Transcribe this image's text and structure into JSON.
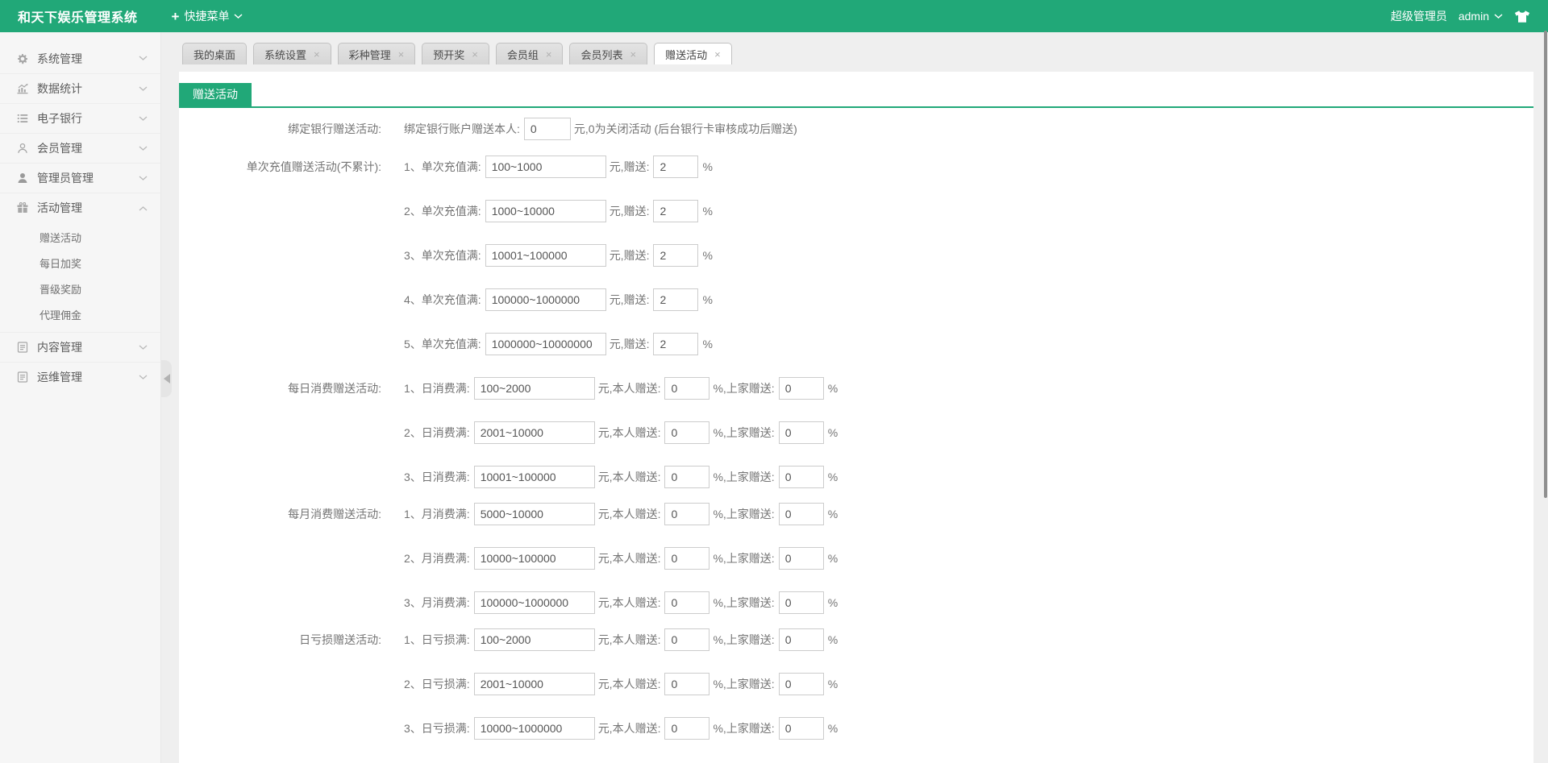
{
  "colors": {
    "primary": "#21a878"
  },
  "ui": {
    "close_glyph": "×"
  },
  "topbar": {
    "title": "和天下娱乐管理系统",
    "plus_glyph": "+",
    "quick_menu": "快捷菜单",
    "role": "超级管理员",
    "username": "admin"
  },
  "sidebar": {
    "items": [
      {
        "label": "系统管理",
        "icon": "gear-icon"
      },
      {
        "label": "数据统计",
        "icon": "bar-chart-icon"
      },
      {
        "label": "电子银行",
        "icon": "list-icon"
      },
      {
        "label": "会员管理",
        "icon": "user-outline-icon"
      },
      {
        "label": "管理员管理",
        "icon": "user-icon"
      },
      {
        "label": "活动管理",
        "icon": "gift-icon",
        "expanded": true,
        "children": [
          "赠送活动",
          "每日加奖",
          "晋级奖励",
          "代理佣金"
        ]
      },
      {
        "label": "内容管理",
        "icon": "content-icon"
      },
      {
        "label": "运维管理",
        "icon": "ops-icon"
      }
    ]
  },
  "tabs": [
    {
      "label": "我的桌面",
      "closable": false,
      "active": false
    },
    {
      "label": "系统设置",
      "closable": true,
      "active": false
    },
    {
      "label": "彩种管理",
      "closable": true,
      "active": false
    },
    {
      "label": "预开奖",
      "closable": true,
      "active": false
    },
    {
      "label": "会员组",
      "closable": true,
      "active": false
    },
    {
      "label": "会员列表",
      "closable": true,
      "active": false
    },
    {
      "label": "赠送活动",
      "closable": true,
      "active": true
    }
  ],
  "content": {
    "section_title": "赠送活动",
    "bind_bank": {
      "group_label": "绑定银行赠送活动:",
      "item_label": "绑定银行账户赠送本人:",
      "value": "0",
      "note": "元,0为关闭活动 (后台银行卡审核成功后赠送)"
    },
    "groups": [
      {
        "label": "单次充值赠送活动(不累计):",
        "mid": "元,赠送:",
        "tail": "%",
        "rows": [
          {
            "label": "1、单次充值满:",
            "range": "100~1000",
            "pct": "2"
          },
          {
            "label": "2、单次充值满:",
            "range": "1000~10000",
            "pct": "2"
          },
          {
            "label": "3、单次充值满:",
            "range": "10001~100000",
            "pct": "2"
          },
          {
            "label": "4、单次充值满:",
            "range": "100000~1000000",
            "pct": "2"
          },
          {
            "label": "5、单次充值满:",
            "range": "1000000~10000000",
            "pct": "2"
          }
        ]
      },
      {
        "label": "每日消费赠送活动:",
        "mid": "元,本人赠送:",
        "mid2": "%,上家赠送:",
        "tail": "%",
        "rows": [
          {
            "label": "1、日消费满:",
            "range": "100~2000",
            "self": "0",
            "parent": "0"
          },
          {
            "label": "2、日消费满:",
            "range": "2001~10000",
            "self": "0",
            "parent": "0"
          },
          {
            "label": "3、日消费满:",
            "range": "10001~100000",
            "self": "0",
            "parent": "0"
          }
        ]
      },
      {
        "label": "每月消费赠送活动:",
        "mid": "元,本人赠送:",
        "mid2": "%,上家赠送:",
        "tail": "%",
        "rows": [
          {
            "label": "1、月消费满:",
            "range": "5000~10000",
            "self": "0",
            "parent": "0"
          },
          {
            "label": "2、月消费满:",
            "range": "10000~100000",
            "self": "0",
            "parent": "0"
          },
          {
            "label": "3、月消费满:",
            "range": "100000~1000000",
            "self": "0",
            "parent": "0"
          }
        ]
      },
      {
        "label": "日亏损赠送活动:",
        "mid": "元,本人赠送:",
        "mid2": "%,上家赠送:",
        "tail": "%",
        "rows": [
          {
            "label": "1、日亏损满:",
            "range": "100~2000",
            "self": "0",
            "parent": "0"
          },
          {
            "label": "2、日亏损满:",
            "range": "2001~10000",
            "self": "0",
            "parent": "0"
          },
          {
            "label": "3、日亏损满:",
            "range": "10000~1000000",
            "self": "0",
            "parent": "0"
          }
        ]
      }
    ]
  }
}
